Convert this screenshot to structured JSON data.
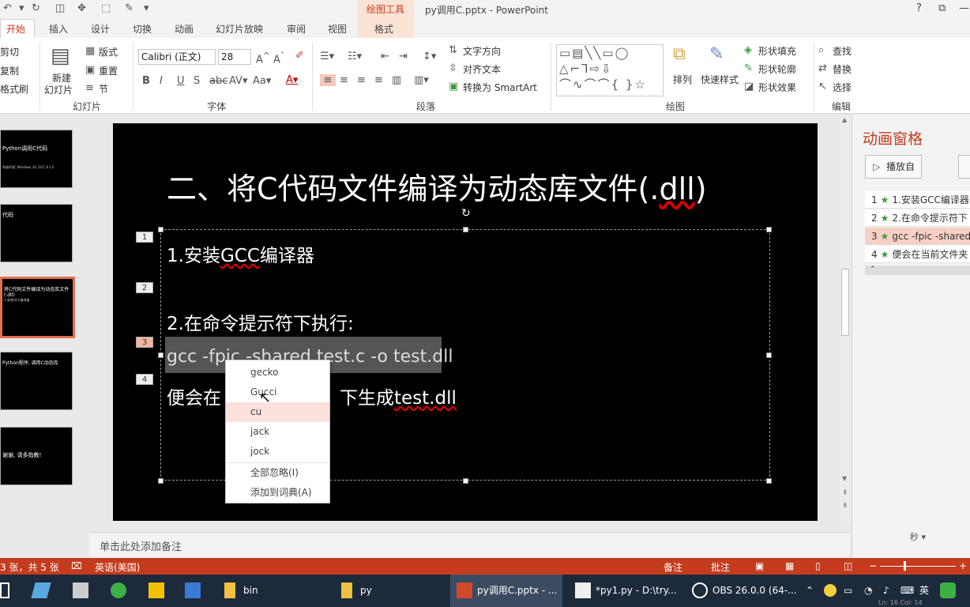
{
  "window": {
    "title": "py调用C.pptx - PowerPoint",
    "context_tool": "绘图工具",
    "help": "?",
    "minimize": "—"
  },
  "tabs": [
    "开始",
    "插入",
    "设计",
    "切换",
    "动画",
    "幻灯片放映",
    "审阅",
    "视图",
    "格式"
  ],
  "ribbon": {
    "clipboard": {
      "cut": "剪切",
      "copy": "复制",
      "painter": "格式刷"
    },
    "slides": {
      "new_slide": "新建",
      "new_slide2": "幻灯片",
      "layout": "版式",
      "reset": "重置",
      "section": "节",
      "group": "幻灯片"
    },
    "font": {
      "name": "Calibri (正文)",
      "size": "28",
      "group": "字体"
    },
    "paragraph": {
      "text_dir": "文字方向",
      "align_text": "对齐文本",
      "smartart": "转换为 SmartArt",
      "group": "段落"
    },
    "drawing": {
      "arrange": "排列",
      "quick_styles": "快速样式",
      "fill": "形状填充",
      "outline": "形状轮廓",
      "effects": "形状效果",
      "group": "绘图"
    },
    "editing": {
      "find": "查找",
      "replace": "替换",
      "select": "选择",
      "group": "编辑"
    }
  },
  "slides_pane": [
    {
      "title": "Python调用C代码",
      "sub": "系统环境: Windows 10, GCC 8.1.0"
    },
    {
      "title": "代码",
      "sub": ""
    },
    {
      "title": "将C代码文件编译为动态库文件(.dll)",
      "sub": "1.安装GCC编译器"
    },
    {
      "title": "Python程序, 调用C动态库",
      "sub": ""
    },
    {
      "title": "谢谢, 请多指教!",
      "sub": ""
    }
  ],
  "slide": {
    "title_main": "二、将C代码文件编译为动态库文件(.",
    "title_dll": "dll",
    "title_end": ")",
    "line1_a": "1.安装",
    "line1_b": "GCC",
    "line1_c": "编译器",
    "line2": "2.在命令提示符下执行:",
    "line3": "gcc -fpic -shared test.c -o test.dll",
    "line4_a": "便会在",
    "line4_b": "下生成",
    "line4_c": "test.dll",
    "anim_nums": [
      "1",
      "2",
      "3",
      "4"
    ]
  },
  "context_menu": {
    "suggestions": [
      "gecko",
      "Gucci",
      "cu",
      "jack",
      "jock"
    ],
    "ignore_all": "全部忽略(I)",
    "add_dict": "添加到词典(A)"
  },
  "notes_placeholder": "单击此处添加备注",
  "anim_pane": {
    "title": "动画窗格",
    "play": "播放自",
    "items": [
      {
        "n": "1",
        "text": "1.安装GCC编译器"
      },
      {
        "n": "2",
        "text": "2.在命令提示符下"
      },
      {
        "n": "3",
        "text": "gcc -fpic -shared"
      },
      {
        "n": "4",
        "text": "便会在当前文件夹"
      }
    ],
    "seconds": "秒"
  },
  "status": {
    "slide_info": "3 张，共 5 张",
    "language": "英语(美国)",
    "notes": "备注",
    "comments": "批注"
  },
  "taskbar": {
    "items": [
      "bin",
      "py",
      "py调用C.pptx - ...",
      "*py1.py - D:\\try...",
      "OBS 26.0.0 (64-..."
    ],
    "ime": "英",
    "clock": "Ln: 16  Col: 14"
  },
  "colors": {
    "accent": "#c43b1d",
    "slide_bg": "#000000",
    "taskbar": "#1c2a3c"
  }
}
